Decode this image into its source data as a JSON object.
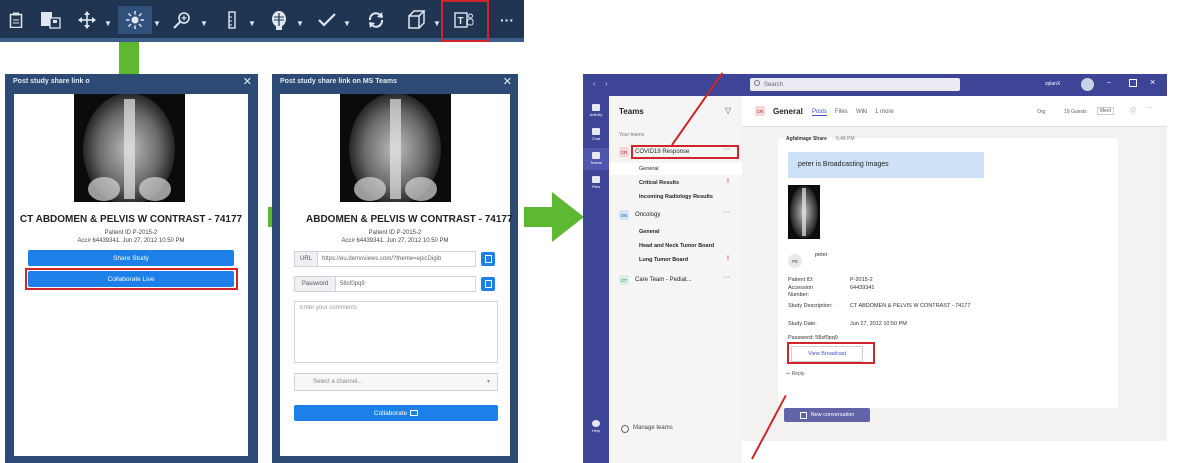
{
  "toolbar": {
    "icons": [
      "clipboard-icon",
      "report-icon",
      "move-icon",
      "brightness-icon",
      "zoom-icon",
      "ruler-icon",
      "anatomy-icon",
      "check-icon",
      "sync-icon",
      "cube-icon",
      "teams-icon",
      "more-icon"
    ],
    "more_label": "···"
  },
  "dialog1": {
    "title": "Post study share link o",
    "close": "✕",
    "study_title": "CT ABDOMEN & PELVIS W CONTRAST - 74177",
    "patient_id": "Patient ID P-2015-2",
    "acc": "Acc# 64439341, Jun 27, 2012 10:50 PM",
    "share_button": "Share Study",
    "collaborate_button": "Collaborate Live"
  },
  "dialog2": {
    "title": "Post study share link on MS Teams",
    "close": "✕",
    "study_title": "ABDOMEN & PELVIS W CONTRAST - 74177",
    "patient_id": "Patient ID P-2015-2",
    "acc": "Acc# 64439341, Jun 27, 2012 10:50 PM",
    "url_label": "URL",
    "url_value": "https://eu.demoviews.com/?theme=epicDigib",
    "password_label": "Password",
    "password_value": "58sf0pq9",
    "comments_placeholder": "Enter your comments",
    "channel_placeholder": "Select a channel...",
    "collaborate_button": "Collaborate"
  },
  "teams": {
    "search_placeholder": "Search",
    "user_label": "zplanX",
    "rail": [
      "Activity",
      "Chat",
      "Teams",
      "Files",
      "Help"
    ],
    "list_header": "Teams",
    "your_teams": "Your teams",
    "team1": {
      "abbr": "CR",
      "name": "COVID19 Response",
      "channels": [
        "General",
        "Critical Results",
        "Incoming Radiology Results"
      ]
    },
    "team2": {
      "abbr": "ON",
      "name": "Oncology",
      "channels": [
        "General",
        "Head and Neck Tumor Board",
        "Lung Tumor Board"
      ]
    },
    "team3": {
      "abbr": "CT",
      "name": "Care Team - Pediat..."
    },
    "manage_teams": "Manage teams",
    "channel_badge": "CR",
    "channel_name": "General",
    "tabs": [
      "Posts",
      "Files",
      "Wiki",
      "1 more"
    ],
    "org_label": "Org",
    "guests_label": "19 Guests",
    "meet_label": "Meet",
    "post": {
      "author": "AgfaImage Share",
      "time": "5:48 PM",
      "banner": "peter is Broadcasting Images",
      "avatar": "PE",
      "user": "peter",
      "patient_id_label": "Patient ID:",
      "patient_id": "P-2015-2",
      "accession_label": "Accession Number:",
      "accession": "64439341",
      "study_desc_label": "Study Description:",
      "study_desc": "CT ABDOMEN & PELVIS W CONTRAST - 74177",
      "study_date_label": "Study Date:",
      "study_date": "Jun 27, 2012 10:50 PM",
      "password": "Password: 58sf0pq9",
      "view_button": "View Broadcast",
      "reply": "Reply"
    },
    "new_conversation": "New conversation"
  },
  "colors": {
    "toolbar": "#1f3552",
    "dialog": "#2c4a73",
    "primary": "#1d7fe8",
    "teams": "#3f4596",
    "highlight": "#d0262b",
    "arrow": "#5fb832"
  }
}
